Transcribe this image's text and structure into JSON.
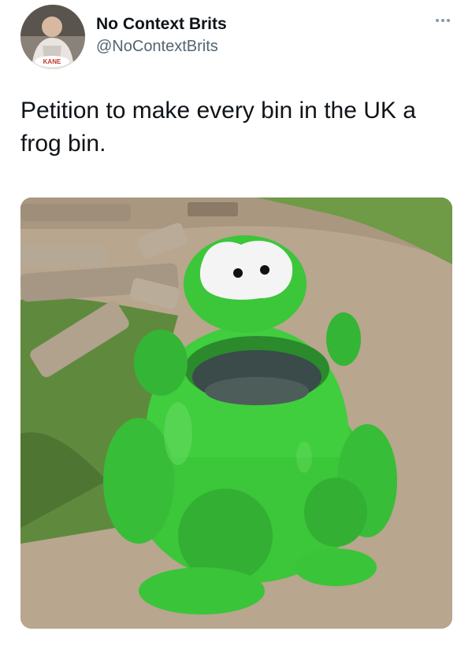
{
  "tweet": {
    "author": {
      "display_name": "No Context Brits",
      "handle": "@NoContextBrits",
      "avatar_icon": "profile-photo",
      "avatar_caption": "KANE"
    },
    "more_icon": "ellipsis-icon",
    "text": "Petition to make every bin in the UK a frog bin.",
    "media": {
      "type": "photo",
      "icon": "frog-bin-photo"
    }
  },
  "colors": {
    "text_primary": "#0f1419",
    "text_secondary": "#536471",
    "frog_green": "#3cc63a",
    "ground": "#b8a68f",
    "grass": "#5f8a3e"
  }
}
